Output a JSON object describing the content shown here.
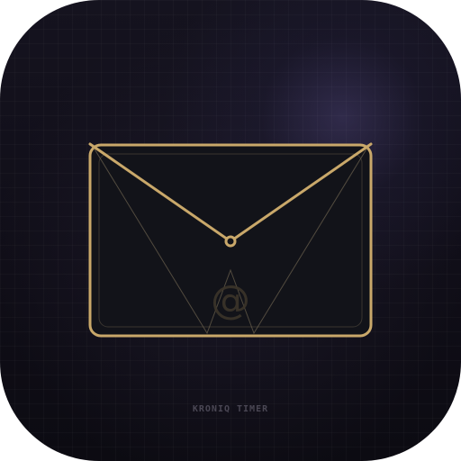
{
  "icon": {
    "at_glyph": "@",
    "brand_label": "KRONIQ TIMER",
    "glyph_name": "envelope-icon"
  },
  "colors": {
    "background": "#13111c",
    "envelope_stroke": "#c9a86a",
    "envelope_fill": "#121319",
    "guide_lines": "#6e6450",
    "brand_label": "#4a4754"
  }
}
